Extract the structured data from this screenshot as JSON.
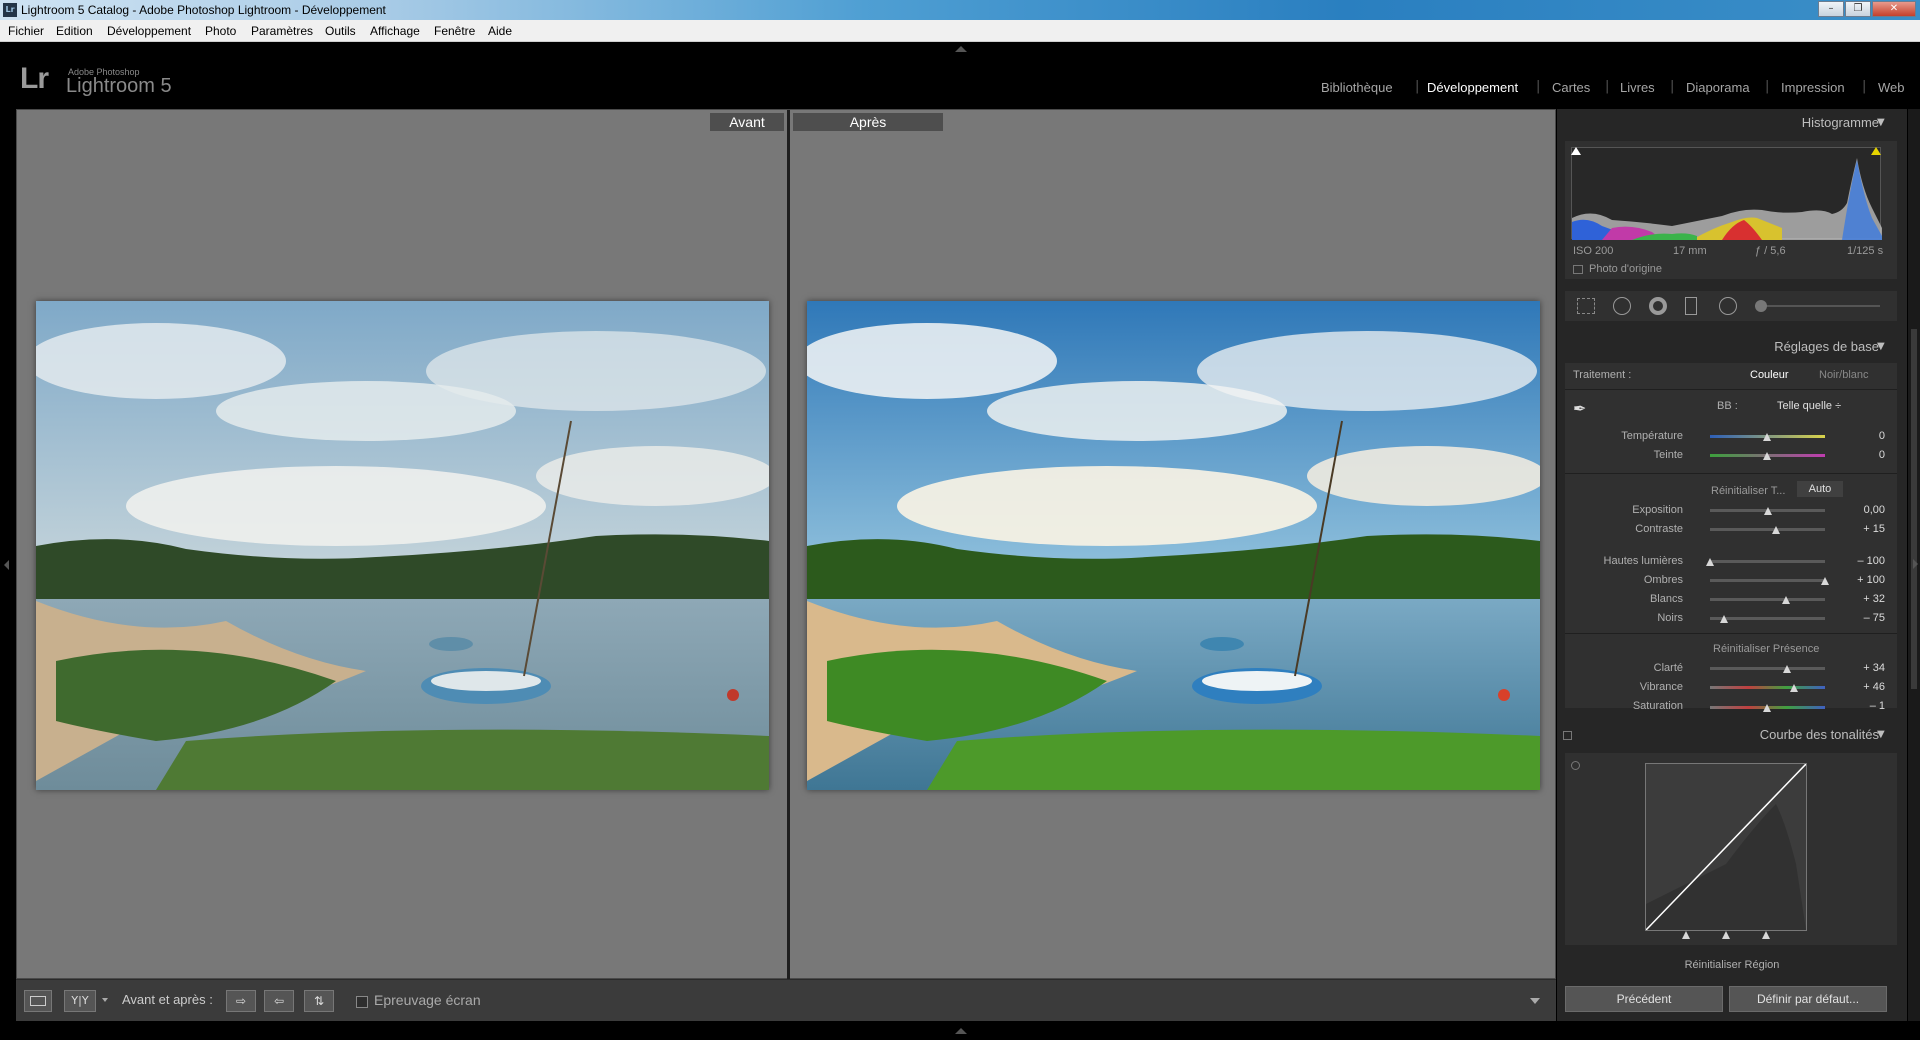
{
  "window": {
    "title": "Lightroom 5 Catalog - Adobe Photoshop Lightroom - Développement",
    "app_icon": "Lr",
    "controls": [
      "minimize-icon",
      "restore-icon",
      "close-icon"
    ]
  },
  "menu": [
    "Fichier",
    "Edition",
    "Développement",
    "Photo",
    "Paramètres",
    "Outils",
    "Affichage",
    "Fenêtre",
    "Aide"
  ],
  "identity": {
    "logo": "Lr",
    "small": "Adobe Photoshop",
    "name": "Lightroom 5"
  },
  "modules": [
    {
      "label": "Bibliothèque",
      "active": false
    },
    {
      "label": "Développement",
      "active": true
    },
    {
      "label": "Cartes",
      "active": false
    },
    {
      "label": "Livres",
      "active": false
    },
    {
      "label": "Diaporama",
      "active": false
    },
    {
      "label": "Impression",
      "active": false
    },
    {
      "label": "Web",
      "active": false
    }
  ],
  "compare": {
    "before_label": "Avant",
    "after_label": "Après"
  },
  "toolbar": {
    "view_mode_label": "Y|Y",
    "before_after_label": "Avant et après :",
    "proof_label": "Epreuvage écran",
    "proof_checked": false
  },
  "right_panel": {
    "histogram": {
      "title": "Histogramme",
      "iso": "ISO 200",
      "focal": "17 mm",
      "aperture": "ƒ / 5,6",
      "shutter": "1/125 s",
      "original_label": "Photo d'origine"
    },
    "basic": {
      "title": "Réglages de base",
      "treatment_label": "Traitement :",
      "color_label": "Couleur",
      "bw_label": "Noir/blanc",
      "wb_label": "BB :",
      "wb_value": "Telle quelle ÷",
      "temp": {
        "label": "Température",
        "value": "0"
      },
      "tint": {
        "label": "Teinte",
        "value": "0"
      },
      "tone_reset_label": "Réinitialiser T...",
      "auto_label": "Auto",
      "exposure": {
        "label": "Exposition",
        "value": "0,00",
        "level": 0
      },
      "contrast": {
        "label": "Contraste",
        "value": "+ 15",
        "level": 15
      },
      "highlights": {
        "label": "Hautes lumières",
        "value": "– 100",
        "level": -100
      },
      "shadows": {
        "label": "Ombres",
        "value": "+ 100",
        "level": 100
      },
      "whites": {
        "label": "Blancs",
        "value": "+ 32",
        "level": 32
      },
      "blacks": {
        "label": "Noirs",
        "value": "– 75",
        "level": -75
      },
      "presence_reset_label": "Réinitialiser Présence",
      "clarity": {
        "label": "Clarté",
        "value": "+ 34",
        "level": 34
      },
      "vibrance": {
        "label": "Vibrance",
        "value": "+ 46",
        "level": 46
      },
      "saturation": {
        "label": "Saturation",
        "value": "– 1",
        "level": -1
      }
    },
    "tone_curve": {
      "title": "Courbe des tonalités",
      "reset_label": "Réinitialiser Région"
    },
    "previous_label": "Précédent",
    "default_label": "Définir par défaut..."
  }
}
